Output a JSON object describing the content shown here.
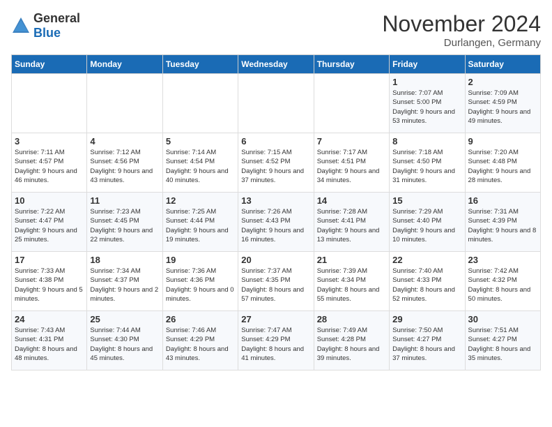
{
  "header": {
    "logo_general": "General",
    "logo_blue": "Blue",
    "month_title": "November 2024",
    "location": "Durlangen, Germany"
  },
  "days_of_week": [
    "Sunday",
    "Monday",
    "Tuesday",
    "Wednesday",
    "Thursday",
    "Friday",
    "Saturday"
  ],
  "weeks": [
    [
      {
        "day": "",
        "info": ""
      },
      {
        "day": "",
        "info": ""
      },
      {
        "day": "",
        "info": ""
      },
      {
        "day": "",
        "info": ""
      },
      {
        "day": "",
        "info": ""
      },
      {
        "day": "1",
        "info": "Sunrise: 7:07 AM\nSunset: 5:00 PM\nDaylight: 9 hours and 53 minutes."
      },
      {
        "day": "2",
        "info": "Sunrise: 7:09 AM\nSunset: 4:59 PM\nDaylight: 9 hours and 49 minutes."
      }
    ],
    [
      {
        "day": "3",
        "info": "Sunrise: 7:11 AM\nSunset: 4:57 PM\nDaylight: 9 hours and 46 minutes."
      },
      {
        "day": "4",
        "info": "Sunrise: 7:12 AM\nSunset: 4:56 PM\nDaylight: 9 hours and 43 minutes."
      },
      {
        "day": "5",
        "info": "Sunrise: 7:14 AM\nSunset: 4:54 PM\nDaylight: 9 hours and 40 minutes."
      },
      {
        "day": "6",
        "info": "Sunrise: 7:15 AM\nSunset: 4:52 PM\nDaylight: 9 hours and 37 minutes."
      },
      {
        "day": "7",
        "info": "Sunrise: 7:17 AM\nSunset: 4:51 PM\nDaylight: 9 hours and 34 minutes."
      },
      {
        "day": "8",
        "info": "Sunrise: 7:18 AM\nSunset: 4:50 PM\nDaylight: 9 hours and 31 minutes."
      },
      {
        "day": "9",
        "info": "Sunrise: 7:20 AM\nSunset: 4:48 PM\nDaylight: 9 hours and 28 minutes."
      }
    ],
    [
      {
        "day": "10",
        "info": "Sunrise: 7:22 AM\nSunset: 4:47 PM\nDaylight: 9 hours and 25 minutes."
      },
      {
        "day": "11",
        "info": "Sunrise: 7:23 AM\nSunset: 4:45 PM\nDaylight: 9 hours and 22 minutes."
      },
      {
        "day": "12",
        "info": "Sunrise: 7:25 AM\nSunset: 4:44 PM\nDaylight: 9 hours and 19 minutes."
      },
      {
        "day": "13",
        "info": "Sunrise: 7:26 AM\nSunset: 4:43 PM\nDaylight: 9 hours and 16 minutes."
      },
      {
        "day": "14",
        "info": "Sunrise: 7:28 AM\nSunset: 4:41 PM\nDaylight: 9 hours and 13 minutes."
      },
      {
        "day": "15",
        "info": "Sunrise: 7:29 AM\nSunset: 4:40 PM\nDaylight: 9 hours and 10 minutes."
      },
      {
        "day": "16",
        "info": "Sunrise: 7:31 AM\nSunset: 4:39 PM\nDaylight: 9 hours and 8 minutes."
      }
    ],
    [
      {
        "day": "17",
        "info": "Sunrise: 7:33 AM\nSunset: 4:38 PM\nDaylight: 9 hours and 5 minutes."
      },
      {
        "day": "18",
        "info": "Sunrise: 7:34 AM\nSunset: 4:37 PM\nDaylight: 9 hours and 2 minutes."
      },
      {
        "day": "19",
        "info": "Sunrise: 7:36 AM\nSunset: 4:36 PM\nDaylight: 9 hours and 0 minutes."
      },
      {
        "day": "20",
        "info": "Sunrise: 7:37 AM\nSunset: 4:35 PM\nDaylight: 8 hours and 57 minutes."
      },
      {
        "day": "21",
        "info": "Sunrise: 7:39 AM\nSunset: 4:34 PM\nDaylight: 8 hours and 55 minutes."
      },
      {
        "day": "22",
        "info": "Sunrise: 7:40 AM\nSunset: 4:33 PM\nDaylight: 8 hours and 52 minutes."
      },
      {
        "day": "23",
        "info": "Sunrise: 7:42 AM\nSunset: 4:32 PM\nDaylight: 8 hours and 50 minutes."
      }
    ],
    [
      {
        "day": "24",
        "info": "Sunrise: 7:43 AM\nSunset: 4:31 PM\nDaylight: 8 hours and 48 minutes."
      },
      {
        "day": "25",
        "info": "Sunrise: 7:44 AM\nSunset: 4:30 PM\nDaylight: 8 hours and 45 minutes."
      },
      {
        "day": "26",
        "info": "Sunrise: 7:46 AM\nSunset: 4:29 PM\nDaylight: 8 hours and 43 minutes."
      },
      {
        "day": "27",
        "info": "Sunrise: 7:47 AM\nSunset: 4:29 PM\nDaylight: 8 hours and 41 minutes."
      },
      {
        "day": "28",
        "info": "Sunrise: 7:49 AM\nSunset: 4:28 PM\nDaylight: 8 hours and 39 minutes."
      },
      {
        "day": "29",
        "info": "Sunrise: 7:50 AM\nSunset: 4:27 PM\nDaylight: 8 hours and 37 minutes."
      },
      {
        "day": "30",
        "info": "Sunrise: 7:51 AM\nSunset: 4:27 PM\nDaylight: 8 hours and 35 minutes."
      }
    ]
  ]
}
